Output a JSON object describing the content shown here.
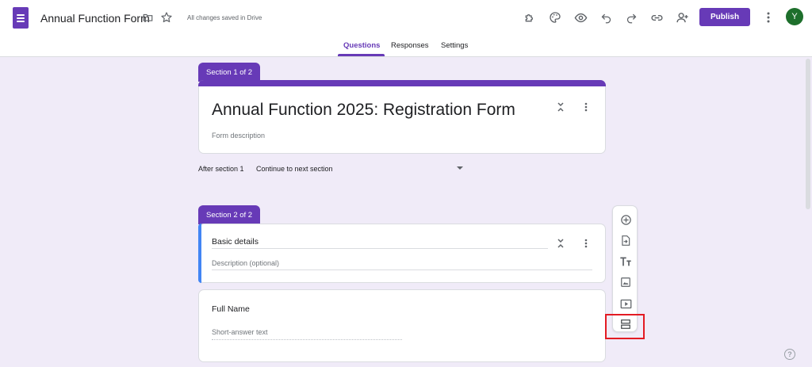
{
  "header": {
    "form_title": "Annual Function Form",
    "save_status": "All changes saved in Drive",
    "publish_label": "Publish",
    "avatar_initial": "Y"
  },
  "tabs": [
    "Questions",
    "Responses",
    "Settings"
  ],
  "section1": {
    "tab_label": "Section 1 of 2",
    "title": "Annual Function 2025: Registration Form",
    "description_placeholder": "Form description"
  },
  "after_section": {
    "label": "After section 1",
    "value": "Continue to next section"
  },
  "section2": {
    "tab_label": "Section 2 of 2",
    "title": "Basic details",
    "description_placeholder": "Description (optional)"
  },
  "question": {
    "title": "Full Name",
    "answer_placeholder": "Short-answer text"
  },
  "toolbar_icons": [
    "add-question-icon",
    "import-questions-icon",
    "add-title-icon",
    "add-image-icon",
    "add-video-icon",
    "add-section-icon"
  ],
  "colors": {
    "primary": "#673ab7",
    "background": "#f0ebf8",
    "accent_blue": "#4285f4",
    "highlight_red": "#e31b23",
    "avatar_green": "#1e6f2c"
  }
}
